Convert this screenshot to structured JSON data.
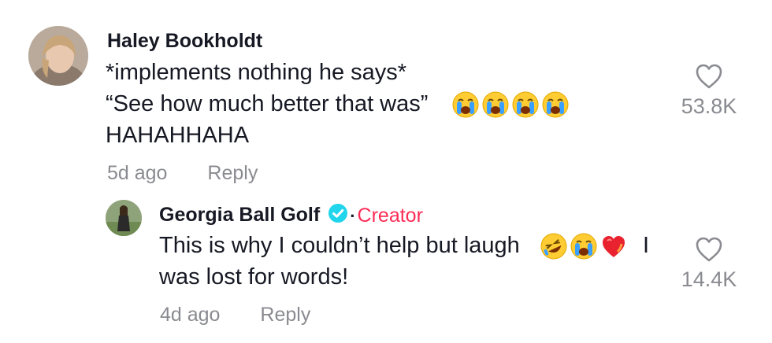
{
  "comments": [
    {
      "username": "Haley Bookholdt",
      "lines": [
        "*implements nothing he says*",
        "“See how much better that was”",
        "HAHAHHAHA"
      ],
      "time": "5d ago",
      "reply_label": "Reply",
      "likes": "53.8K",
      "emojis": [
        "loudly-crying-face",
        "loudly-crying-face",
        "loudly-crying-face",
        "loudly-crying-face"
      ]
    }
  ],
  "reply": {
    "username": "Georgia Ball Golf",
    "verified": true,
    "dot": "·",
    "badge": "Creator",
    "lines": [
      "This is why I couldn’t help but laugh",
      "I",
      "was lost for words!"
    ],
    "time": "4d ago",
    "reply_label": "Reply",
    "likes": "14.4K",
    "emojis": [
      "rolling-on-floor-laughing",
      "loudly-crying-face",
      "heart-on-fire"
    ]
  },
  "colors": {
    "creator": "#fe2c55",
    "verified": "#20d5ec",
    "muted": "#8a8b91"
  }
}
